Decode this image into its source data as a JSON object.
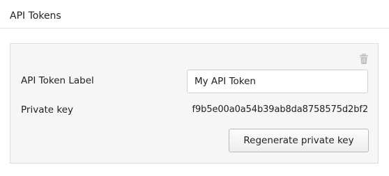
{
  "section": {
    "title": "API Tokens"
  },
  "token": {
    "label_field_label": "API Token Label",
    "label_value": "My API Token",
    "private_key_label": "Private key",
    "private_key_value": "f9b5e00a0a54b39ab8da8758575d2bf2",
    "regenerate_label": "Regenerate private key",
    "delete_icon": "trash-icon"
  },
  "colors": {
    "panel_background": "#f6f6f6",
    "panel_border": "#dcdcdc",
    "icon_gray": "#bdbdbd"
  }
}
